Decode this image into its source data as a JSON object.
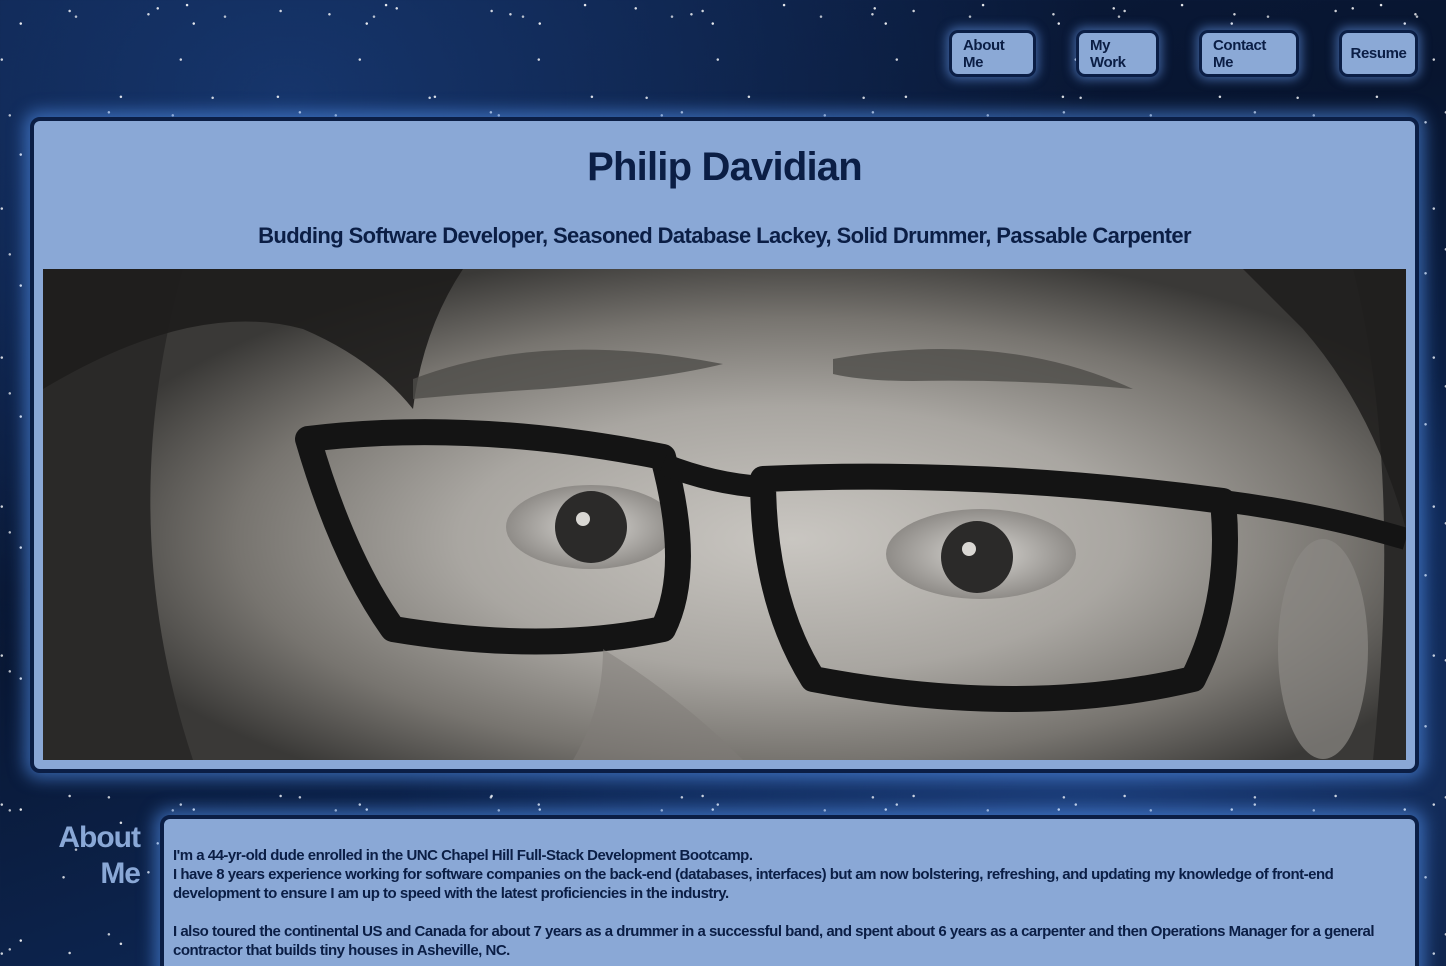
{
  "nav": {
    "items": [
      {
        "label": "About Me"
      },
      {
        "label": "My Work"
      },
      {
        "label": "Contact Me"
      },
      {
        "label": "Resume"
      }
    ]
  },
  "hero": {
    "name": "Philip Davidian",
    "tagline": "Budding Software Developer, Seasoned Database Lackey, Solid Drummer, Passable Carpenter",
    "photo_description_icon": "portrait-photo"
  },
  "about": {
    "heading_line1": "About",
    "heading_line2": "Me",
    "paragraph1_line1": "I'm a 44-yr-old dude enrolled in the UNC Chapel Hill Full-Stack Development Bootcamp.",
    "paragraph1_line2": "I have 8 years experience working for software companies on the back-end (databases, interfaces) but am now bolstering, refreshing, and updating my knowledge of front-end development to ensure I am up to speed with the latest proficiencies in the industry.",
    "paragraph2": "I also toured the continental US and Canada for about 7 years as a drummer in a successful band, and spent about 6 years as a carpenter and then Operations Manager for a general contractor that builds tiny houses in Asheville, NC."
  },
  "colors": {
    "panel": "#8aa8d6",
    "text_dark": "#0b1e45",
    "glow": "#5a8ce6"
  }
}
